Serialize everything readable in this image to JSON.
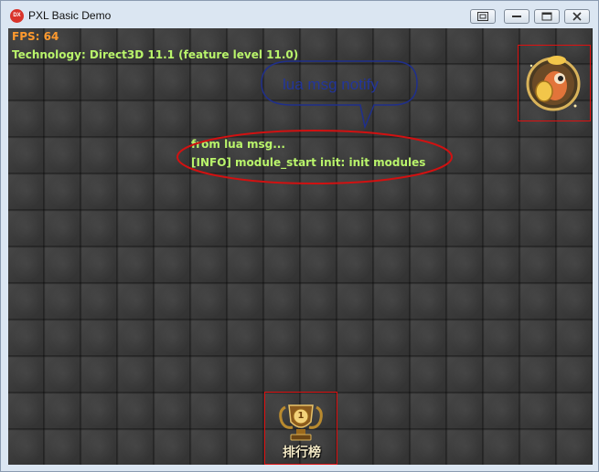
{
  "window": {
    "title": "PXL Basic Demo",
    "icon_label": "DX"
  },
  "hud": {
    "fps": "FPS: 64",
    "technology": "Technology: Direct3D 11.1 (feature level 11.0)"
  },
  "log": {
    "lines": [
      "from lua msg...",
      "[INFO] module_start init: init modules"
    ]
  },
  "annotations": {
    "bubble_text": "lua msg notify"
  },
  "rank": {
    "label": "排行榜",
    "badge_number": "1"
  },
  "colors": {
    "fps": "#ff9a2e",
    "text_green": "#b9f46b",
    "annotation_red": "#d11111",
    "bubble_blue": "#1f2f8c"
  },
  "icons": [
    "restore-window-icon",
    "minimize-icon",
    "maximize-icon",
    "close-icon",
    "trophy-icon",
    "avatar-icon"
  ]
}
